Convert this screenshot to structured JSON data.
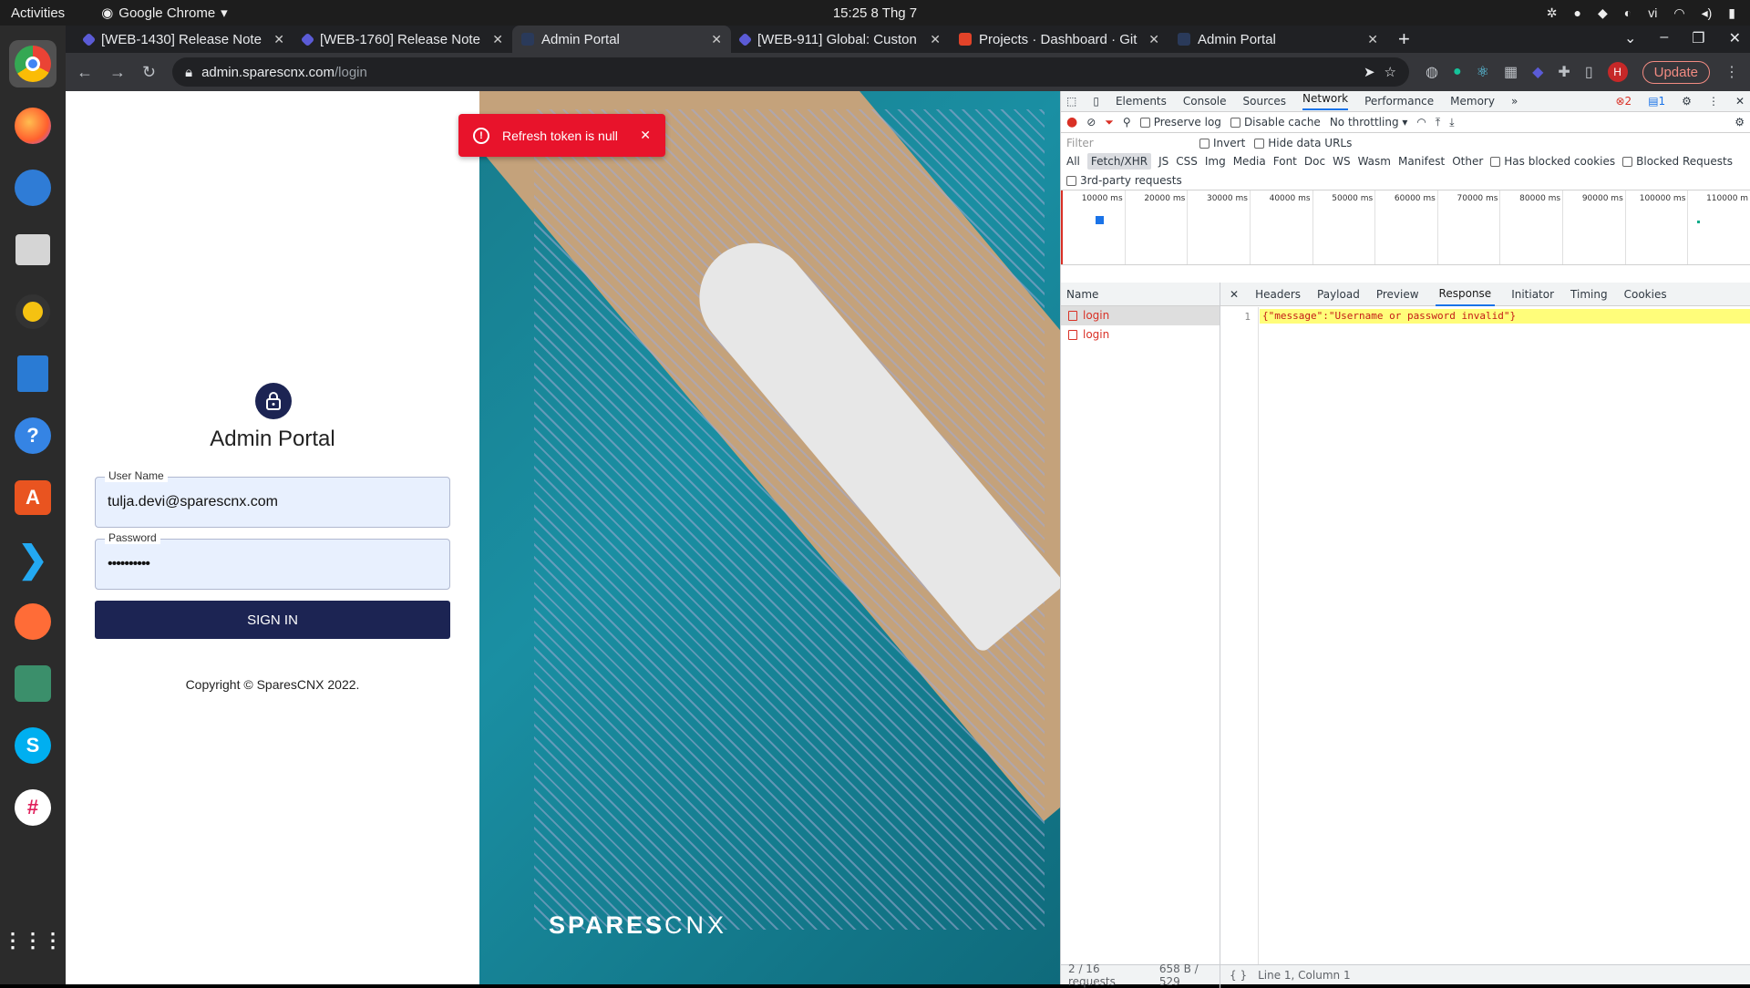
{
  "topbar": {
    "activities": "Activities",
    "app": "Google Chrome",
    "clock": "15:25  8 Thg 7",
    "lang": "vi"
  },
  "dock": [
    "chrome-icon",
    "firefox-icon",
    "thunderbird-icon",
    "files-icon",
    "rhythmbox-icon",
    "writer-icon",
    "help-icon",
    "software-icon",
    "vscode-icon",
    "postman-icon",
    "app-icon",
    "skype-icon",
    "slack-icon"
  ],
  "tabs": [
    {
      "title": "[WEB-1430] Release Note",
      "fav": "#5b5bd6"
    },
    {
      "title": "[WEB-1760] Release Note",
      "fav": "#5b5bd6"
    },
    {
      "title": "Admin Portal",
      "fav": "#2a3a5a"
    },
    {
      "title": "[WEB-911] Global: Custon",
      "fav": "#5b5bd6"
    },
    {
      "title": "Projects · Dashboard · Git",
      "fav": "#e24329"
    },
    {
      "title": "Admin Portal",
      "fav": "#2a3a5a"
    }
  ],
  "omnibox": {
    "host": "admin.sparescnx.com",
    "path": "/login",
    "update": "Update",
    "avatar": "H"
  },
  "login": {
    "title": "Admin Portal",
    "username_label": "User Name",
    "username_value": "tulja.devi@sparescnx.com",
    "password_label": "Password",
    "password_value": "••••••••••",
    "signin": "SIGN IN",
    "copyright": "Copyright © SparesCNX 2022."
  },
  "toast": {
    "message": "Refresh token is null"
  },
  "photo": {
    "logo_bold": "SPARES",
    "logo_light": "CNX"
  },
  "devtools": {
    "tabs": [
      "Elements",
      "Console",
      "Sources",
      "Network",
      "Performance",
      "Memory"
    ],
    "errors": "2",
    "messages": "1",
    "toolbar": {
      "preserve": "Preserve log",
      "disable": "Disable cache",
      "throttle": "No throttling"
    },
    "filter_placeholder": "Filter",
    "invert": "Invert",
    "hide_data": "Hide data URLs",
    "types": [
      "All",
      "Fetch/XHR",
      "JS",
      "CSS",
      "Img",
      "Media",
      "Font",
      "Doc",
      "WS",
      "Wasm",
      "Manifest",
      "Other"
    ],
    "blocked_cookies": "Has blocked cookies",
    "blocked_requests": "Blocked Requests",
    "third_party": "3rd-party requests",
    "timeline": [
      "10000 ms",
      "20000 ms",
      "30000 ms",
      "40000 ms",
      "50000 ms",
      "60000 ms",
      "70000 ms",
      "80000 ms",
      "90000 ms",
      "100000 ms",
      "110000 m"
    ],
    "name_header": "Name",
    "requests": [
      "login",
      "login"
    ],
    "detail_tabs": [
      "Headers",
      "Payload",
      "Preview",
      "Response",
      "Initiator",
      "Timing",
      "Cookies"
    ],
    "response_line_no": "1",
    "response_body": "{\"message\":\"Username or password invalid\"}",
    "status_requests": "2 / 16 requests",
    "status_size": "658 B / 529",
    "status_pos": "Line 1, Column 1"
  }
}
